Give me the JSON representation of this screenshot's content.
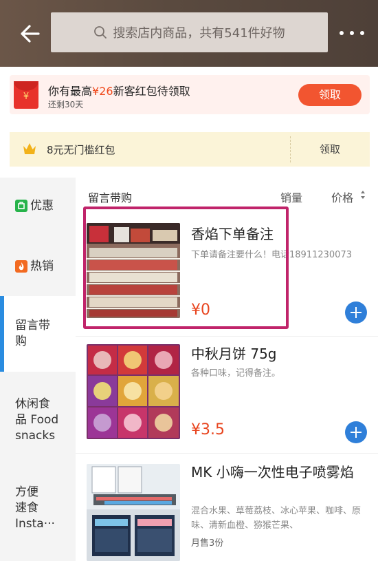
{
  "header": {
    "search_placeholder": "搜索店内商品，共有541件好物",
    "colors": {
      "bar": "#5a4a3f"
    }
  },
  "promo": {
    "title_prefix": "你有最高",
    "amount": "¥26",
    "title_suffix": "新客红包待领取",
    "subtitle": "还剩30天",
    "button": "领取",
    "icon_symbol": "¥",
    "colors": {
      "accent": "#f25530"
    }
  },
  "coupon": {
    "text": "8元无门槛红包",
    "button": "领取"
  },
  "sidebar": {
    "items": [
      {
        "label": "优惠",
        "icon": "discount-icon"
      },
      {
        "label": "热销",
        "icon": "flame-icon"
      },
      {
        "label": "留言带\n购",
        "active": true
      },
      {
        "label": "休闲食\n品 Food\nsnacks"
      },
      {
        "label": "方便\n速食\nInsta···"
      }
    ]
  },
  "list": {
    "section_title": "留言带购",
    "sort_sales": "销量",
    "sort_price": "价格"
  },
  "products": [
    {
      "name": "香焰下单备注",
      "desc": "下单请备注要什么！电话18911230073",
      "price": "¥0"
    },
    {
      "name": "中秋月饼 75g",
      "desc": "各种口味，记得备注。",
      "price": "¥3.5"
    },
    {
      "name": "MK 小嗨一次性电子喷雾焰",
      "desc": "混合水果、草莓荔枝、冰心苹果、咖啡、原味、清新血橙、猕猴芒果、",
      "sold": "月售3份"
    }
  ]
}
